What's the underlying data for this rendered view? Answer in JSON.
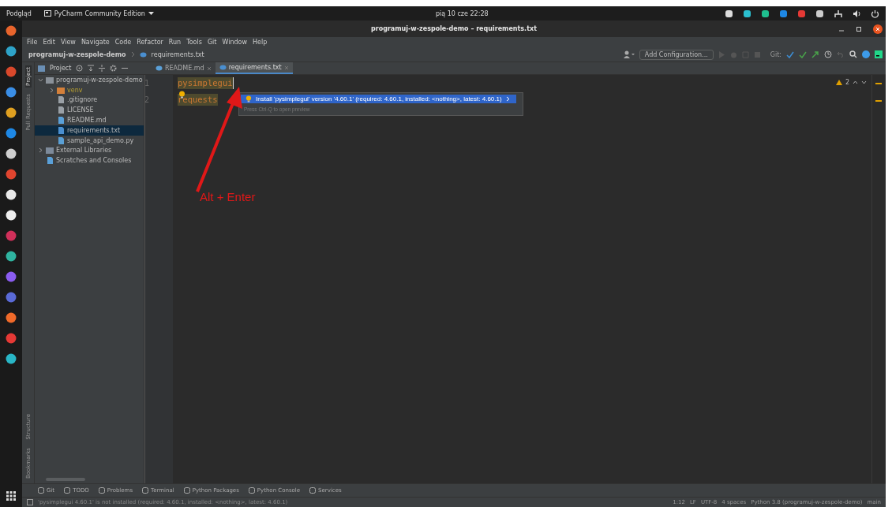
{
  "system_bar": {
    "activities": "Podgląd",
    "app_menu": "PyCharm Community Edition",
    "clock": "pią 10 cze  22:28"
  },
  "window": {
    "title": "programuj-w-zespole-demo – requirements.txt"
  },
  "menu": [
    "File",
    "Edit",
    "View",
    "Navigate",
    "Code",
    "Refactor",
    "Run",
    "Tools",
    "Git",
    "Window",
    "Help"
  ],
  "breadcrumb": [
    "programuj-w-zespole-demo",
    "requirements.txt"
  ],
  "toolbar": {
    "add_configuration": "Add Configuration...",
    "git_label": "Git:"
  },
  "side_tabs_top": [
    {
      "label": "Project",
      "selected": true
    },
    {
      "label": "Pull Requests",
      "selected": false
    }
  ],
  "side_tabs_bottom": [
    "Structure",
    "Bookmarks"
  ],
  "project_header": "Project",
  "tabs": [
    {
      "label": "README.md",
      "kind": "markdown",
      "selected": false
    },
    {
      "label": "requirements.txt",
      "kind": "text",
      "selected": true
    }
  ],
  "tree": [
    {
      "label": "programuj-w-zespole-demo",
      "kind": "folder",
      "expanded": true,
      "selected": false,
      "children": [
        {
          "label": "venv",
          "kind": "excluded",
          "expanded": false,
          "selected": false
        },
        {
          "label": ".gitignore",
          "kind": "file",
          "selected": false
        },
        {
          "label": "LICENSE",
          "kind": "file",
          "selected": false
        },
        {
          "label": "README.md",
          "kind": "markdown",
          "selected": false
        },
        {
          "label": "requirements.txt",
          "kind": "text",
          "selected": true
        },
        {
          "label": "sample_api_demo.py",
          "kind": "python",
          "selected": false
        }
      ]
    },
    {
      "label": "External Libraries",
      "kind": "libraries",
      "expanded": false,
      "selected": false
    },
    {
      "label": "Scratches and Consoles",
      "kind": "scratches",
      "selected": false
    }
  ],
  "editor": {
    "lines": [
      {
        "number": "1",
        "text": "pysimplegui"
      },
      {
        "number": "2",
        "text": "requests"
      }
    ],
    "warning_count": "2"
  },
  "intention_popup": {
    "action": "Install 'pysimplegui' version '4.60.1' (required: 4.60.1, installed: <nothing>, latest: 4.60.1)",
    "hint": "Press Ctrl-Q to open preview"
  },
  "annotation": "Alt + Enter",
  "tool_windows": [
    "Git",
    "TODO",
    "Problems",
    "Terminal",
    "Python Packages",
    "Python Console",
    "Services"
  ],
  "status_bar": {
    "message": "'pysimplegui 4.60.1' is not installed (required: 4.60.1, installed: <nothing>, latest: 4.60.1)",
    "items": [
      "1:12",
      "LF",
      "UTF-8",
      "4 spaces",
      "Python 3.8 (programuj-w-zespole-demo)",
      "main"
    ]
  }
}
